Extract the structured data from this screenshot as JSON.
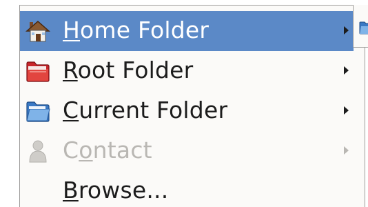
{
  "menu": {
    "items": [
      {
        "pre": "",
        "mnemonic": "H",
        "post": "ome Folder",
        "icon": "home-folder-icon",
        "has_submenu": true,
        "state": "selected"
      },
      {
        "pre": "",
        "mnemonic": "R",
        "post": "oot Folder",
        "icon": "root-folder-icon",
        "has_submenu": true,
        "state": "normal"
      },
      {
        "pre": "",
        "mnemonic": "C",
        "post": "urrent Folder",
        "icon": "current-folder-icon",
        "has_submenu": true,
        "state": "normal"
      },
      {
        "pre": "C",
        "mnemonic": "o",
        "post": "ntact",
        "icon": "contact-icon",
        "has_submenu": true,
        "state": "disabled"
      },
      {
        "pre": "",
        "mnemonic": "B",
        "post": "rowse...",
        "icon": "",
        "has_submenu": false,
        "state": "normal"
      }
    ]
  },
  "submenu": {
    "icon": "folder-icon"
  },
  "colors": {
    "selection": "#5b89c7",
    "menu_background": "#fbfaf8",
    "disabled_text": "#b9b7b3"
  }
}
